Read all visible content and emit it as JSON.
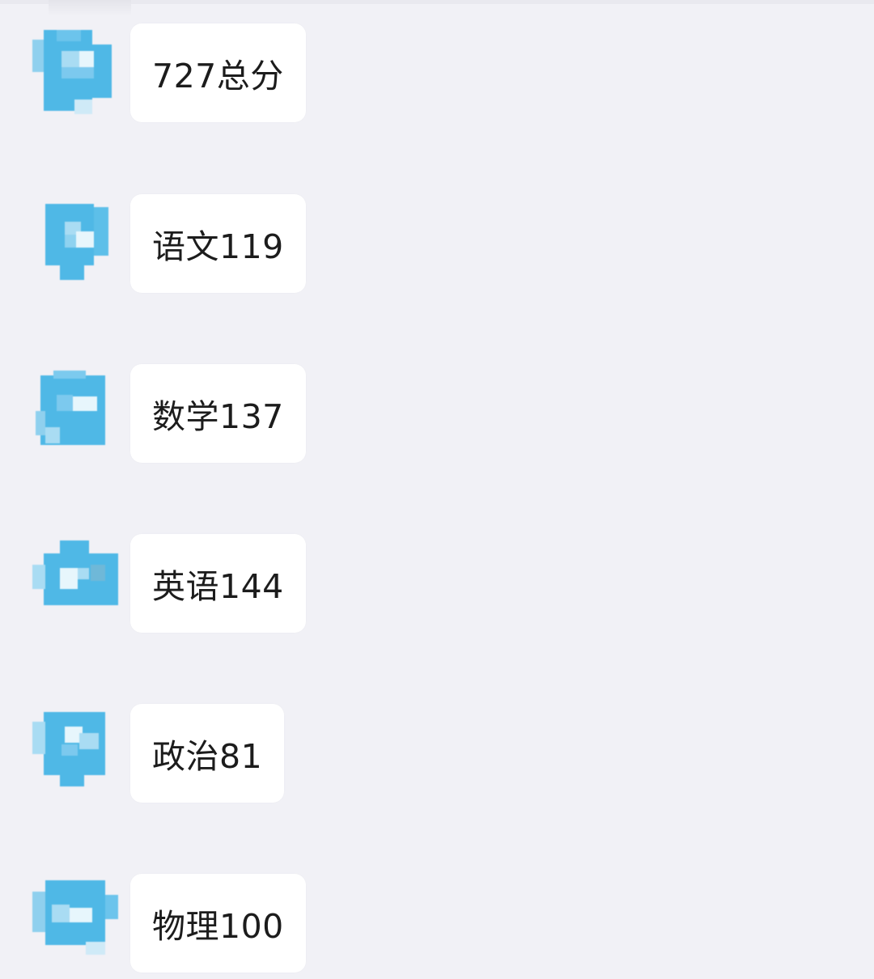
{
  "colors": {
    "background": "#f1f1f6",
    "bubble": "#ffffff",
    "text": "#1c1c1c",
    "avatar_blue": "#4fb8e6",
    "avatar_light": "#a9dcf3",
    "avatar_pale": "#e7f6fc"
  },
  "messages": [
    {
      "text": "727总分",
      "avatar_icon": "pixelated-avatar-icon"
    },
    {
      "text": "语文119",
      "avatar_icon": "pixelated-avatar-icon"
    },
    {
      "text": "数学137",
      "avatar_icon": "pixelated-avatar-icon"
    },
    {
      "text": "英语144",
      "avatar_icon": "pixelated-avatar-icon"
    },
    {
      "text": "政治81",
      "avatar_icon": "pixelated-avatar-icon"
    },
    {
      "text": "物理100",
      "avatar_icon": "pixelated-avatar-icon"
    }
  ]
}
